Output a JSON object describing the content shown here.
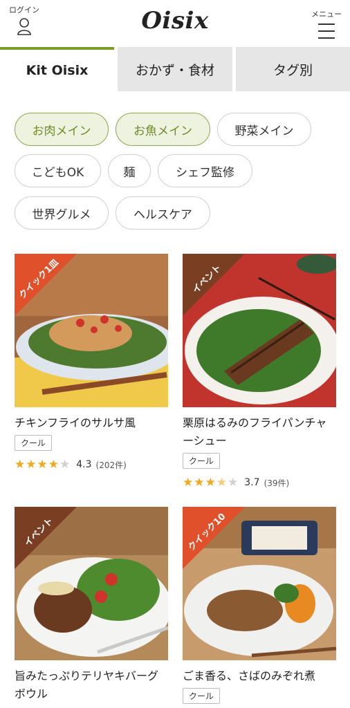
{
  "header": {
    "login_label": "ログイン",
    "logo": "Oisix",
    "menu_label": "メニュー"
  },
  "tabs": [
    {
      "label": "Kit Oisix"
    },
    {
      "label": "おかず・食材"
    },
    {
      "label": "タグ別"
    }
  ],
  "chips": [
    {
      "label": "お肉メイン"
    },
    {
      "label": "お魚メイン"
    },
    {
      "label": "野菜メイン"
    },
    {
      "label": "こどもOK"
    },
    {
      "label": "麺"
    },
    {
      "label": "シェフ監修"
    },
    {
      "label": "世界グルメ"
    },
    {
      "label": "ヘルスケア"
    }
  ],
  "cards": [
    {
      "ribbon": "クイック1皿",
      "title": "チキンフライのサルサ風",
      "tag": "クール",
      "score": "4.3",
      "count": "(202件)",
      "stars_value": 4.3
    },
    {
      "ribbon": "イベント",
      "title": "栗原はるみのフライパンチャーシュー",
      "tag": "クール",
      "score": "3.7",
      "count": "(39件)",
      "stars_value": 3.7
    },
    {
      "ribbon": "イベント",
      "title": "旨みたっぷりテリヤキバーグボウル",
      "tag": "",
      "score": "",
      "count": ""
    },
    {
      "ribbon": "クイック10",
      "title": "ごま香る、さばのみぞれ煮",
      "tag": "クール",
      "score": "",
      "count": ""
    }
  ],
  "colors": {
    "accent": "#7a9a2a",
    "ribbon_orange": "#e0502a",
    "ribbon_brown": "#7a3f23",
    "star": "#f0a81f"
  }
}
